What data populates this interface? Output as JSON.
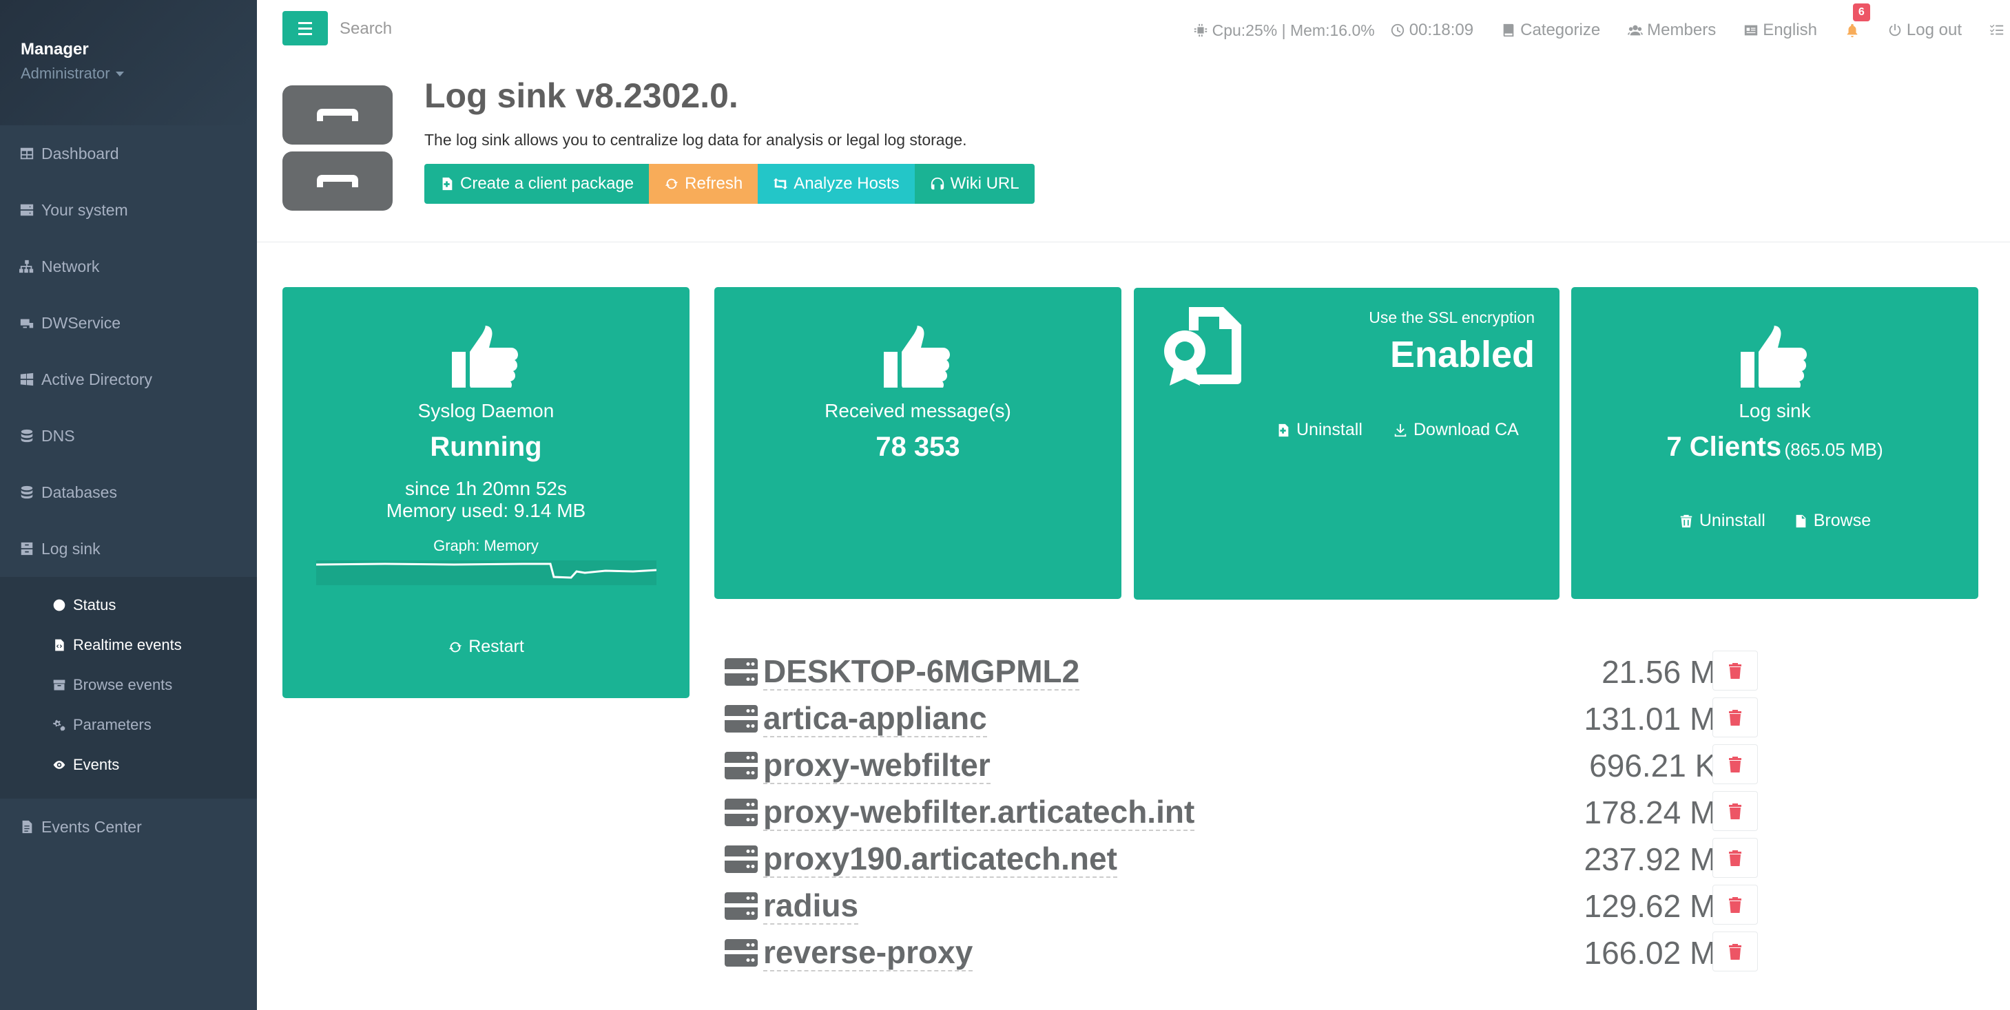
{
  "profile": {
    "name": "Manager",
    "role": "Administrator"
  },
  "sidebar": {
    "items": [
      {
        "label": "Dashboard"
      },
      {
        "label": "Your system"
      },
      {
        "label": "Network"
      },
      {
        "label": "DWService"
      },
      {
        "label": "Active Directory"
      },
      {
        "label": "DNS"
      },
      {
        "label": "Databases"
      },
      {
        "label": "Log sink"
      }
    ],
    "subitems": [
      {
        "label": "Status"
      },
      {
        "label": "Realtime events"
      },
      {
        "label": "Browse events"
      },
      {
        "label": "Parameters"
      },
      {
        "label": "Events"
      }
    ],
    "events_center": "Events Center"
  },
  "topbar": {
    "search_placeholder": "Search",
    "cpu_mem": "Cpu:25% | Mem:16.0%",
    "uptime": "00:18:09",
    "categorize": "Categorize",
    "members": "Members",
    "language": "English",
    "notifications": "6",
    "logout": "Log out"
  },
  "header": {
    "title": "Log sink v8.2302.0.",
    "description": "The log sink allows you to centralize log data for analysis or legal log storage.",
    "buttons": {
      "create": "Create a client package",
      "refresh": "Refresh",
      "analyze": "Analyze Hosts",
      "wiki": "Wiki URL"
    }
  },
  "widgets": {
    "syslog": {
      "label": "Syslog Daemon",
      "status": "Running",
      "since": "since 1h 20mn 52s",
      "memory": "Memory used: 9.14 MB",
      "graph_label": "Graph: Memory",
      "restart": "Restart"
    },
    "received": {
      "label": "Received message(s)",
      "value": "78 353"
    },
    "ssl": {
      "label": "Use the SSL encryption",
      "status": "Enabled",
      "uninstall": "Uninstall",
      "download": "Download CA"
    },
    "logsink": {
      "label": "Log sink",
      "clients": "7 Clients",
      "size": "(865.05 MB)",
      "uninstall": "Uninstall",
      "browse": "Browse"
    }
  },
  "hosts": [
    {
      "name": "DESKTOP-6MGPML2",
      "size": "21.56 MB"
    },
    {
      "name": "artica-applianc",
      "size": "131.01 MB"
    },
    {
      "name": "proxy-webfilter",
      "size": "696.21 KB"
    },
    {
      "name": "proxy-webfilter.articatech.int",
      "size": "178.24 MB"
    },
    {
      "name": "proxy190.articatech.net",
      "size": "237.92 MB"
    },
    {
      "name": "radius",
      "size": "129.62 MB"
    },
    {
      "name": "reverse-proxy",
      "size": "166.02 MB"
    }
  ],
  "colors": {
    "accent": "#1ab394",
    "warning": "#f8ac59",
    "info": "#23c6c8",
    "danger": "#ed5565",
    "sidebar": "#2f4050"
  }
}
